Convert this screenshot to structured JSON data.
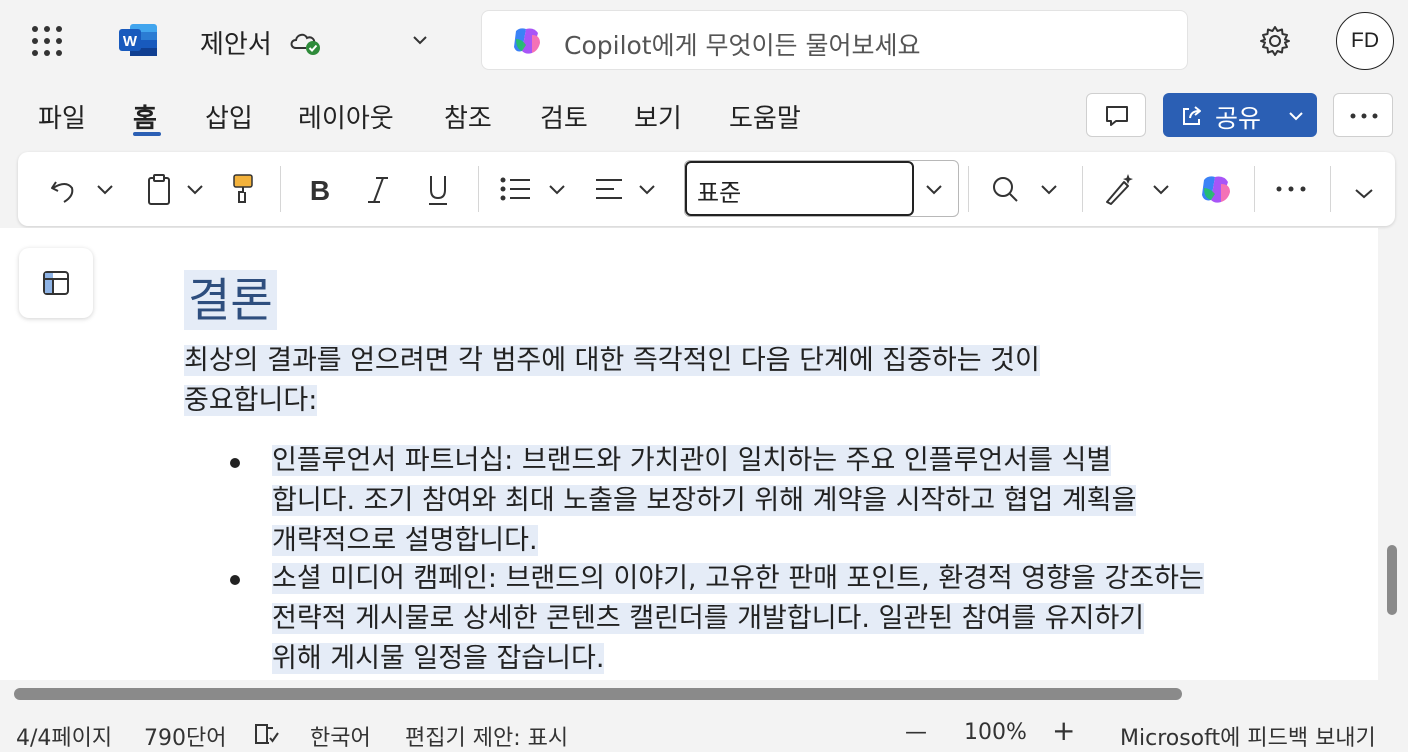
{
  "app": {
    "doc_title": "제안서",
    "copilot_placeholder": "Copilot에게 무엇이든 물어보세요",
    "avatar_initials": "FD",
    "accent_color": "#2b5fb4"
  },
  "tabs": [
    {
      "label": "파일"
    },
    {
      "label": "홈"
    },
    {
      "label": "삽입"
    },
    {
      "label": "레이아웃"
    },
    {
      "label": "참조"
    },
    {
      "label": "검토"
    },
    {
      "label": "보기"
    },
    {
      "label": "도움말"
    }
  ],
  "actions": {
    "share_label": "공유"
  },
  "ribbon": {
    "style_value": "표준",
    "icons": [
      "undo-icon",
      "clipboard-icon",
      "format-painter-icon",
      "bold-icon",
      "italic-icon",
      "underline-icon",
      "bullets-icon",
      "align-icon",
      "find-icon",
      "designer-icon",
      "copilot-icon",
      "more-icon",
      "expand-icon"
    ]
  },
  "document": {
    "heading": "결론",
    "intro_line1": "최상의 결과를 얻으려면 각 범주에 대한 즉각적인 다음 단계에 집중하는 것이",
    "intro_line2": "중요합니다:",
    "bullets": [
      {
        "lines": [
          "인플루언서 파트너십: 브랜드와 가치관이 일치하는 주요 인플루언서를 식별",
          "합니다. 조기 참여와 최대 노출을 보장하기 위해 계약을 시작하고 협업 계획을",
          "개략적으로 설명합니다."
        ]
      },
      {
        "lines": [
          "소셜 미디어 캠페인: 브랜드의 이야기, 고유한 판매 포인트, 환경적 영향을 강조하는",
          "전략적 게시물로 상세한 콘텐츠 캘린더를 개발합니다. 일관된 참여를 유지하기",
          "위해 게시물 일정을 잡습니다."
        ]
      }
    ]
  },
  "status": {
    "page": "4/4페이지",
    "words": "790단어",
    "language": "한국어",
    "editor": "편집기 제안: 표시",
    "zoom_minus": "—",
    "zoom": "100%",
    "zoom_plus": "+",
    "feedback": "Microsoft에 피드백 보내기"
  }
}
